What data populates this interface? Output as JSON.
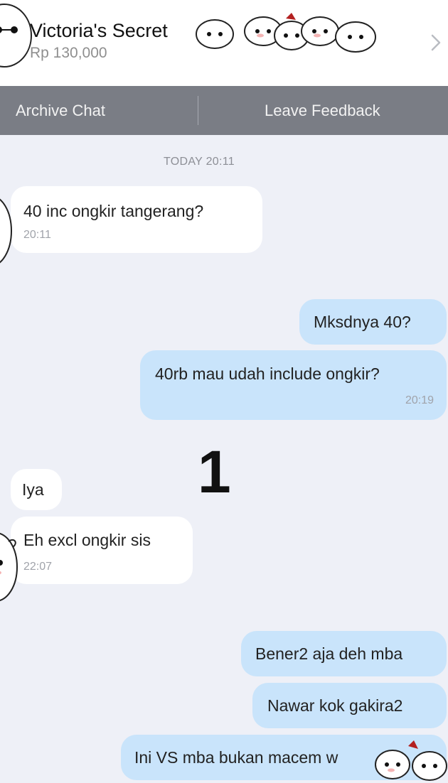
{
  "header": {
    "title": "Victoria's Secret",
    "title_suffix": "..",
    "price": "Rp 130,000"
  },
  "toolbar": {
    "archive_label": "Archive Chat",
    "feedback_label": "Leave Feedback"
  },
  "chat": {
    "date_separator": "TODAY 20:11",
    "messages": [
      {
        "text": "40 inc ongkir tangerang?",
        "time": "20:11"
      },
      {
        "text": "Mksdnya 40?"
      },
      {
        "text": "40rb mau udah include ongkir?",
        "time": "20:19"
      },
      {
        "text": "Iya"
      },
      {
        "text": "Eh excl ongkir sis",
        "time": "22:07"
      },
      {
        "text": "Bener2 aja deh mba"
      },
      {
        "text": "Nawar kok gakira2"
      },
      {
        "text": "Ini VS mba bukan macem w"
      }
    ]
  },
  "overlay": {
    "number": "1"
  },
  "colors": {
    "background": "#eef0f7",
    "toolbar": "#7a7d85",
    "incoming_bubble": "#ffffff",
    "outgoing_bubble": "#c9e4fb"
  },
  "icons": {
    "chevron": "chevron-right-icon",
    "sticker": "baymax-sticker-icon"
  }
}
